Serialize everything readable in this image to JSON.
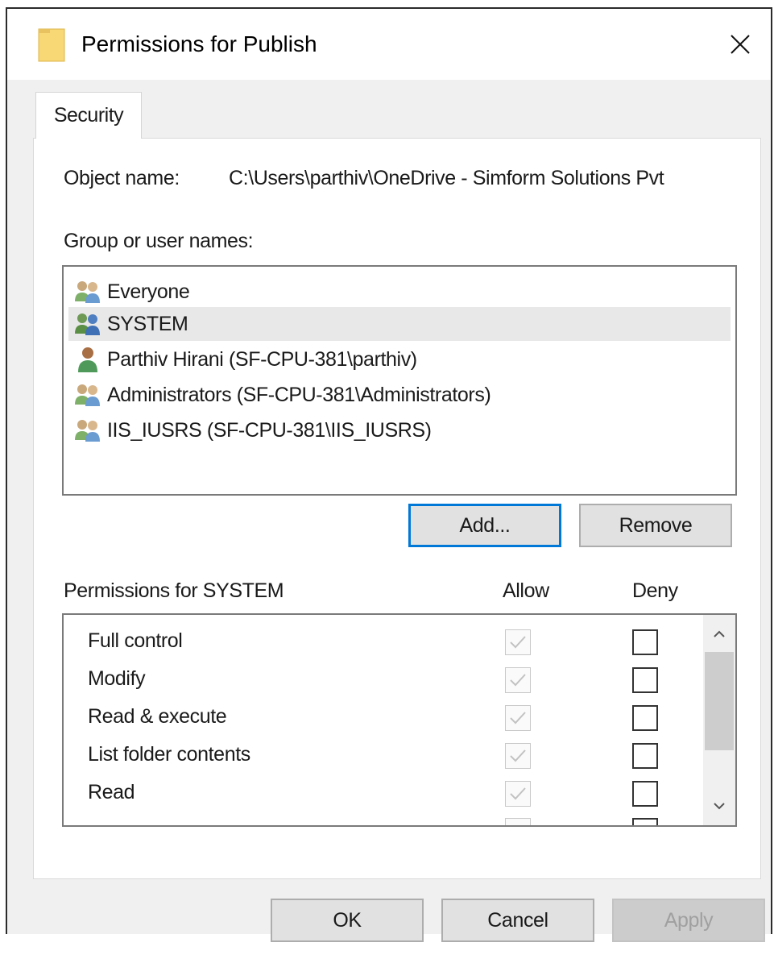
{
  "dialog": {
    "title": "Permissions for Publish",
    "tab_security": "Security",
    "object_name_label": "Object name:",
    "object_name_value": "C:\\Users\\parthiv\\OneDrive - Simform Solutions Pvt",
    "group_label": "Group or user names:",
    "users": [
      {
        "name": "Everyone",
        "icon": "group-icon",
        "selected": false
      },
      {
        "name": "SYSTEM",
        "icon": "group-icon",
        "selected": true
      },
      {
        "name": "Parthiv Hirani (SF-CPU-381\\parthiv)",
        "icon": "user-icon",
        "selected": false
      },
      {
        "name": "Administrators (SF-CPU-381\\Administrators)",
        "icon": "group-icon",
        "selected": false
      },
      {
        "name": "IIS_IUSRS (SF-CPU-381\\IIS_IUSRS)",
        "icon": "group-icon",
        "selected": false
      }
    ],
    "add_label": "Add...",
    "remove_label": "Remove",
    "permissions_for_label": "Permissions for SYSTEM",
    "allow_header": "Allow",
    "deny_header": "Deny",
    "permissions": [
      {
        "name": "Full control",
        "allow": true,
        "deny": false
      },
      {
        "name": "Modify",
        "allow": true,
        "deny": false
      },
      {
        "name": "Read & execute",
        "allow": true,
        "deny": false
      },
      {
        "name": "List folder contents",
        "allow": true,
        "deny": false
      },
      {
        "name": "Read",
        "allow": true,
        "deny": false
      }
    ],
    "ok_label": "OK",
    "cancel_label": "Cancel",
    "apply_label": "Apply"
  },
  "colors": {
    "accent": "#0078d7",
    "window_bg": "#f0f0f0",
    "selected_row": "#e8e8e8",
    "folder": "#f8d775"
  }
}
